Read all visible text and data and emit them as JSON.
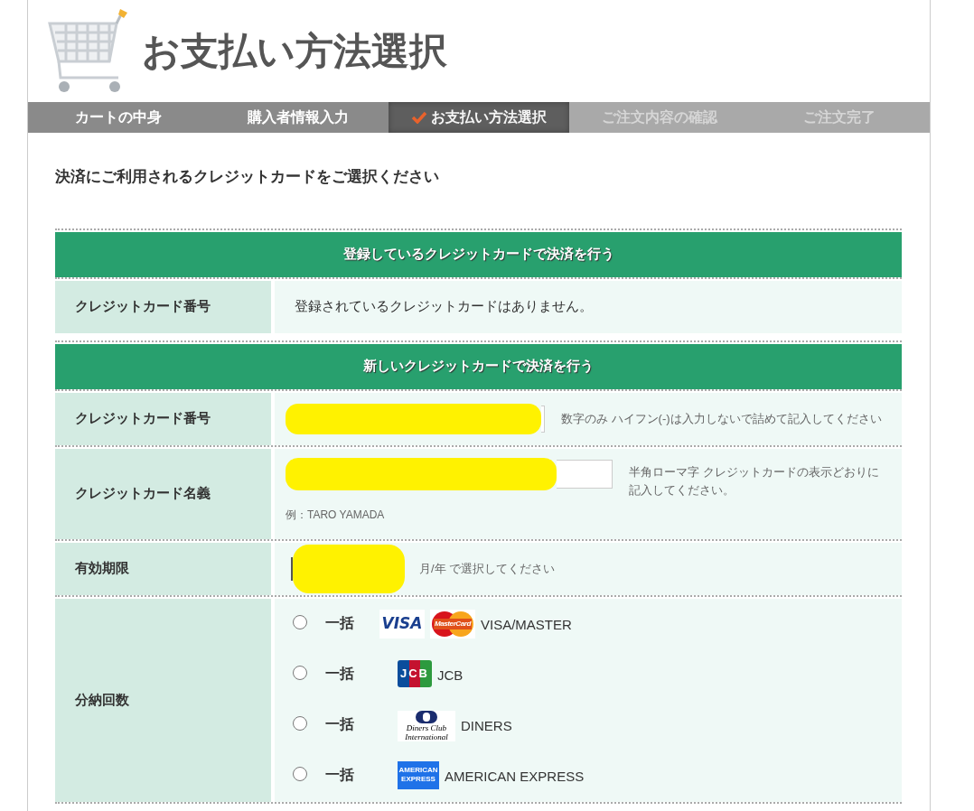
{
  "header": {
    "title": "お支払い方法選択"
  },
  "steps": [
    {
      "label": "カートの中身",
      "done": true,
      "selected": false
    },
    {
      "label": "購入者情報入力",
      "done": true,
      "selected": false
    },
    {
      "label": "お支払い方法選択",
      "done": false,
      "selected": true
    },
    {
      "label": "ご注文内容の確認",
      "done": false,
      "selected": false
    },
    {
      "label": "ご注文完了",
      "done": false,
      "selected": false
    }
  ],
  "instruction": "決済にご利用されるクレジットカードをご選択ください",
  "registered_section": {
    "title": "登録しているクレジットカードで決済を行う",
    "rows": [
      {
        "label": "クレジットカード番号",
        "value": "登録されているクレジットカードはありません。"
      }
    ]
  },
  "new_section": {
    "title": "新しいクレジットカードで決済を行う",
    "card_number": {
      "label": "クレジットカード番号",
      "hint": "数字のみ ハイフン(-)は入力しないで詰めて記入してください"
    },
    "card_name": {
      "label": "クレジットカード名義",
      "hint": "半角ローマ字 クレジットカードの表示どおりに記入してください。",
      "example": "例：TARO YAMADA"
    },
    "expiry": {
      "label": "有効期限",
      "hint": "月/年 で選択してください"
    },
    "installments": {
      "label": "分納回数",
      "options": [
        {
          "plan": "一括",
          "selected": false,
          "logos": [
            {
              "kind": "visa",
              "text": "VISA"
            },
            {
              "kind": "mastercard",
              "text": "MasterCard"
            }
          ],
          "brand": "VISA/MASTER"
        },
        {
          "plan": "一括",
          "selected": false,
          "logos": [
            {
              "kind": "jcb",
              "text": "JCB"
            }
          ],
          "brand": "JCB"
        },
        {
          "plan": "一括",
          "selected": false,
          "logos": [
            {
              "kind": "diners",
              "text": "Diners Club International"
            }
          ],
          "brand": "DINERS"
        },
        {
          "plan": "一括",
          "selected": false,
          "logos": [
            {
              "kind": "amex",
              "text": "AMERICAN EXPRESS"
            }
          ],
          "brand": "AMERICAN EXPRESS"
        }
      ]
    }
  }
}
